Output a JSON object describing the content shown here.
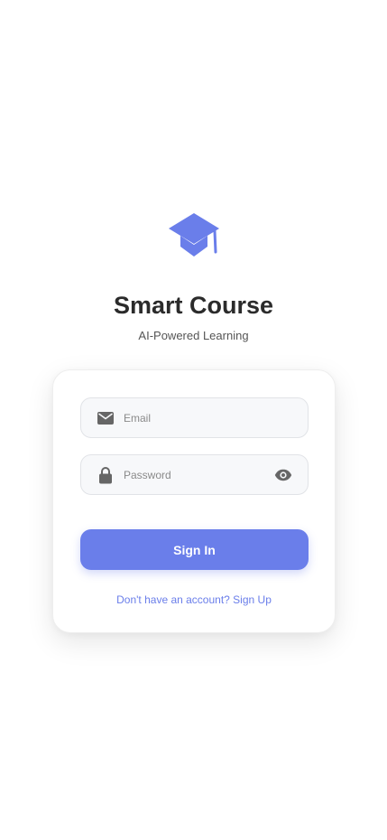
{
  "brand": {
    "title": "Smart Course",
    "subtitle": "AI-Powered Learning",
    "logo_icon": "graduation-cap-icon"
  },
  "login_form": {
    "email_field": {
      "value": "",
      "placeholder": "Email",
      "icon": "envelope-icon"
    },
    "password_field": {
      "value": "",
      "placeholder": "Password",
      "icon": "lock-icon",
      "toggle_icon": "eye-icon"
    },
    "submit_label": "Sign In",
    "signup_link": "Don't have an account? Sign Up"
  },
  "colors": {
    "accent": "#6a7eea",
    "title": "#2b2b2b",
    "icon": "#666666",
    "field_bg": "#f7f8fa"
  }
}
